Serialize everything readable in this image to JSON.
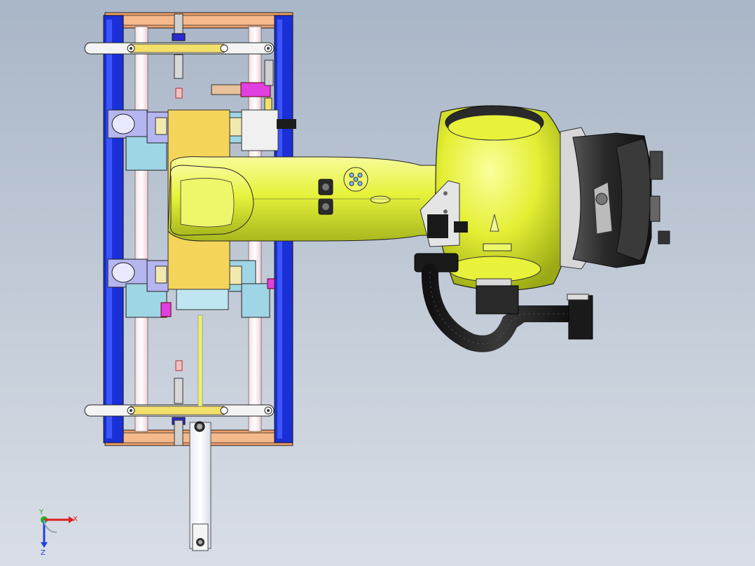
{
  "viewport": {
    "background_top": "#a9b6c7",
    "background_bottom": "#d9dee6"
  },
  "colors": {
    "frame_blue": "#1a2fd6",
    "frame_orange": "#f0a06a",
    "robot_yellow": "#e8f23a",
    "fixture_yellow": "#f5d45a",
    "fixture_cyan": "#9fd6e6",
    "fixture_lilac": "#b5b5f0",
    "accent_magenta": "#e040e0",
    "motor_dark": "#2a2a2a",
    "cable_black": "#1e1e1e"
  },
  "triad": {
    "x_label": "X",
    "y_label": "Y",
    "z_label": "Z",
    "x_color": "#e02020",
    "y_color": "#20b020",
    "z_color": "#2040e0"
  }
}
